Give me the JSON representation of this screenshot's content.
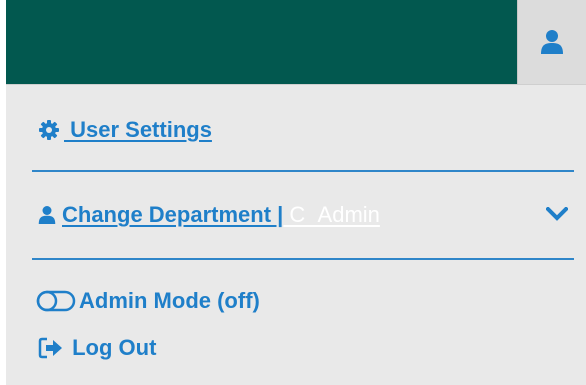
{
  "topbar": {
    "bg_color": "#02584f",
    "user_button_icon": "user-icon",
    "user_button_bg": "#dcdcdc"
  },
  "menu": {
    "accent_color": "#1f7fc9",
    "settings": {
      "icon": "gear-icon",
      "label": " User Settings"
    },
    "department": {
      "icon": "user-icon",
      "label": "Change Department |",
      "value": " C_Admin",
      "toggle_icon": "chevron-down-icon"
    },
    "admin_mode": {
      "icon": "toggle-off-icon",
      "label": "Admin Mode (off)"
    },
    "logout": {
      "icon": "sign-out-icon",
      "label": " Log Out"
    }
  }
}
